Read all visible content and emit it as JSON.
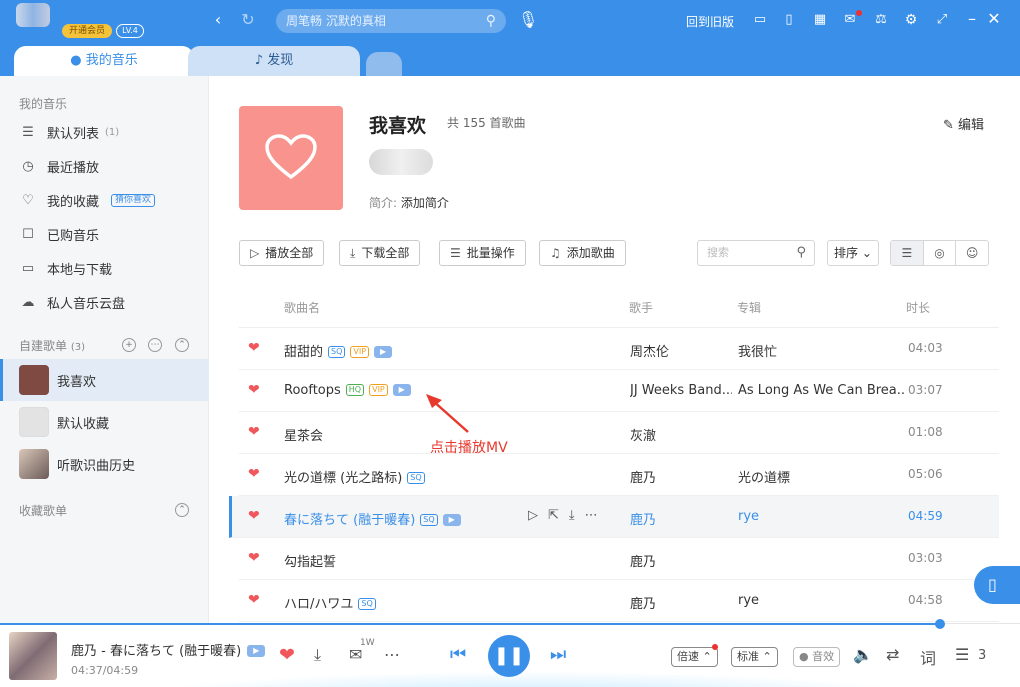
{
  "topbar": {
    "vip_label": "开通会员",
    "level": "LV.4",
    "search_placeholder": "周笔畅 沉默的真相",
    "old_version": "回到旧版",
    "accent": "#3a8fe8"
  },
  "tabs": [
    {
      "label": "我的音乐"
    },
    {
      "label": "发现"
    }
  ],
  "sidebar": {
    "my_music_title": "我的音乐",
    "items": [
      {
        "label": "默认列表",
        "count": "(1)",
        "icon": "list-icon"
      },
      {
        "label": "最近播放",
        "icon": "clock-icon"
      },
      {
        "label": "我的收藏",
        "tag": "猜你喜欢",
        "icon": "heart-icon"
      },
      {
        "label": "已购音乐",
        "icon": "bag-icon"
      },
      {
        "label": "本地与下载",
        "icon": "computer-icon"
      },
      {
        "label": "私人音乐云盘",
        "icon": "cloud-icon"
      }
    ],
    "created_title": "自建歌单",
    "created_count": "(3)",
    "playlists": [
      {
        "label": "我喜欢"
      },
      {
        "label": "默认收藏"
      },
      {
        "label": "听歌识曲历史"
      }
    ],
    "collected_title": "收藏歌单"
  },
  "playlist": {
    "title": "我喜欢",
    "count": "共 155 首歌曲",
    "intro_label": "简介:",
    "intro_value": "添加简介",
    "edit_label": "编辑",
    "cover_color": "#f8938d"
  },
  "actions": {
    "play_all": "播放全部",
    "download_all": "下载全部",
    "batch": "批量操作",
    "add_song": "添加歌曲",
    "filter_placeholder": "搜索",
    "sort": "排序"
  },
  "table": {
    "headers": {
      "name": "歌曲名",
      "artist": "歌手",
      "album": "专辑",
      "duration": "时长"
    },
    "rows": [
      {
        "name": "甜甜的",
        "badges": [
          "SQ",
          "VIP",
          "MV"
        ],
        "artist": "周杰伦",
        "album": "我很忙",
        "duration": "04:03"
      },
      {
        "name": "Rooftops",
        "badges": [
          "HQ",
          "VIP",
          "MV"
        ],
        "artist": "JJ Weeks Band...",
        "album": "As Long As We Can Brea...",
        "duration": "03:07"
      },
      {
        "name": "星茶会",
        "badges": [],
        "artist": "灰澈",
        "album": "",
        "duration": "01:08"
      },
      {
        "name": "光の道標 (光之路标)",
        "badges": [
          "SQ"
        ],
        "artist": "鹿乃",
        "album": "光の道標",
        "duration": "05:06"
      },
      {
        "name": "春に落ちて (融于暖春)",
        "badges": [
          "SQ",
          "MV"
        ],
        "artist": "鹿乃",
        "album": "rye",
        "duration": "04:59"
      },
      {
        "name": "勾指起誓",
        "badges": [],
        "artist": "鹿乃",
        "album": "",
        "duration": "03:03"
      },
      {
        "name": "ハロ/ハワユ",
        "badges": [
          "SQ"
        ],
        "artist": "鹿乃",
        "album": "rye",
        "duration": "04:58"
      }
    ]
  },
  "annotation": "点击播放MV",
  "player": {
    "title": "鹿乃 - 春に落ちて (融于暖春)",
    "time": "04:37/04:59",
    "comment_count": "1W",
    "speed": "倍速",
    "quality": "标准",
    "effect": "音效",
    "lyrics": "词",
    "queue_count": "3",
    "progress": 0.927
  }
}
